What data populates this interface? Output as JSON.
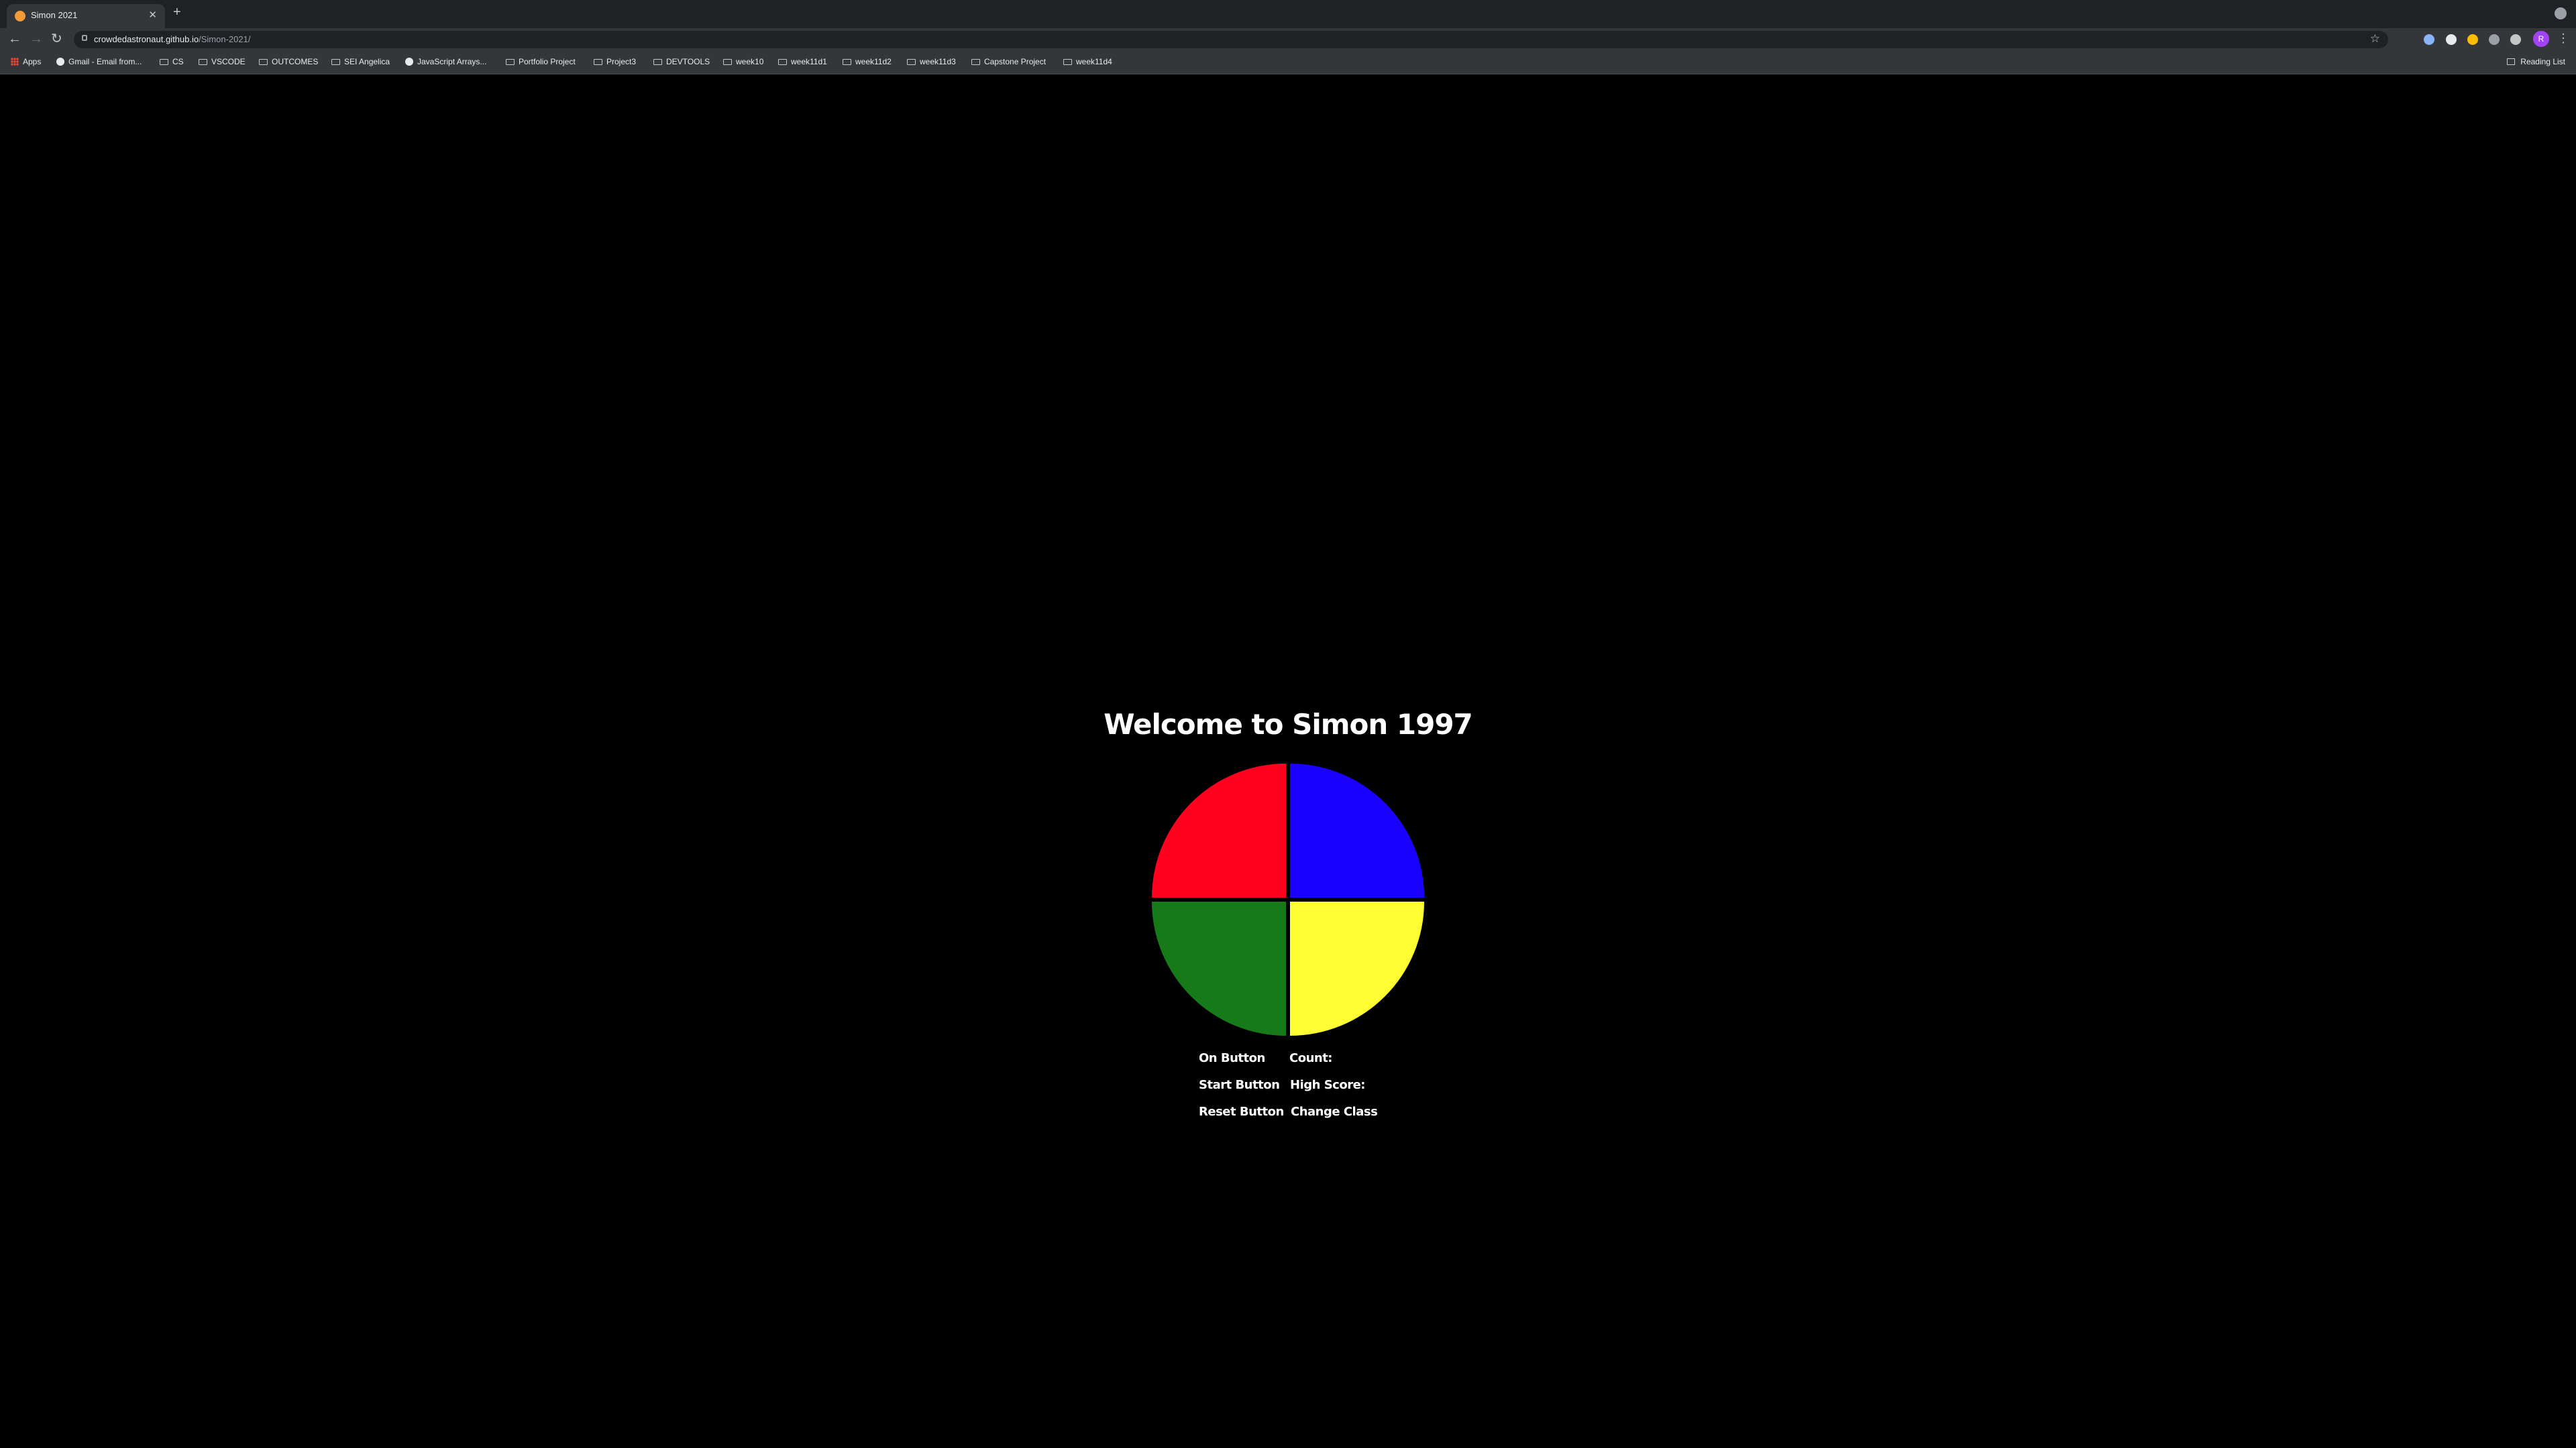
{
  "browser": {
    "tab_title": "Simon 2021",
    "url_host": "crowdedastronaut.github.io",
    "url_path": "/Simon-2021/",
    "profile_initial": "R",
    "bookmarks": [
      "Apps",
      "Gmail - Email from...",
      "CS",
      "VSCODE",
      "OUTCOMES",
      "SEI Angelica",
      "JavaScript Arrays...",
      "Portfolio Project",
      "Project3",
      "DEVTOOLS",
      "week10",
      "week11d1",
      "week11d2",
      "week11d3",
      "Capstone Project",
      "week11d4"
    ],
    "reading_list": "Reading List"
  },
  "game": {
    "title": "Welcome to Simon 1997",
    "colors": {
      "red": "#ff001e",
      "blue": "#1a00ff",
      "green": "#167a18",
      "yellow": "#ffff33"
    },
    "on_button": "On Button",
    "count_label": "Count:",
    "start_button": "Start Button",
    "high_score_label": "High Score:",
    "reset_button": "Reset Button",
    "change_class": "Change Class"
  }
}
